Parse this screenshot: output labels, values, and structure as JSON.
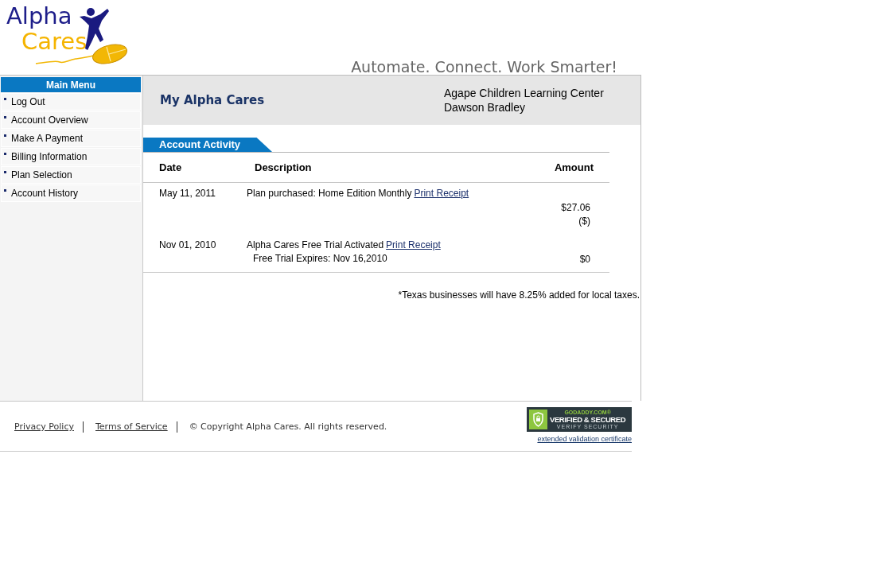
{
  "header": {
    "logo": {
      "line_1": "Alpha",
      "line_2": "Cares"
    },
    "tagline": "Automate. Connect. Work Smarter!"
  },
  "sidebar": {
    "title": "Main Menu",
    "items": [
      {
        "label": "Log Out"
      },
      {
        "label": "Account Overview"
      },
      {
        "label": "Make A Payment"
      },
      {
        "label": "Billing Information"
      },
      {
        "label": "Plan Selection"
      },
      {
        "label": "Account History"
      }
    ]
  },
  "account": {
    "title": "My Alpha Cares",
    "organization": "Agape Children Learning Center",
    "user": "Dawson Bradley"
  },
  "activity": {
    "tab": "Account Activity",
    "columns": [
      "Date",
      "Description",
      "Amount"
    ],
    "rows": [
      {
        "date": "May 11, 2011",
        "description": "Plan purchased: Home Edition Monthly",
        "link": "Print Receipt",
        "amount": "$27.06",
        "amount_note": "($)"
      },
      {
        "date": "Nov 01, 2010",
        "description": "Alpha Cares Free Trial Activated",
        "link": "Print Receipt",
        "detail": "Free Trial Expires: Nov 16,2010",
        "amount": "$0"
      }
    ],
    "note": "*Texas businesses will have 8.25% added for local taxes."
  },
  "footer": {
    "links": [
      "Privacy Policy",
      "Terms of Service"
    ],
    "copyright": "© Copyright Alpha Cares. All rights reserved.",
    "seal": {
      "brand": "GODADDY.COM®",
      "title": "VERIFIED & SECURED",
      "subtitle": "VERIFY SECURITY"
    },
    "seal_link": "extended validation certificate"
  }
}
